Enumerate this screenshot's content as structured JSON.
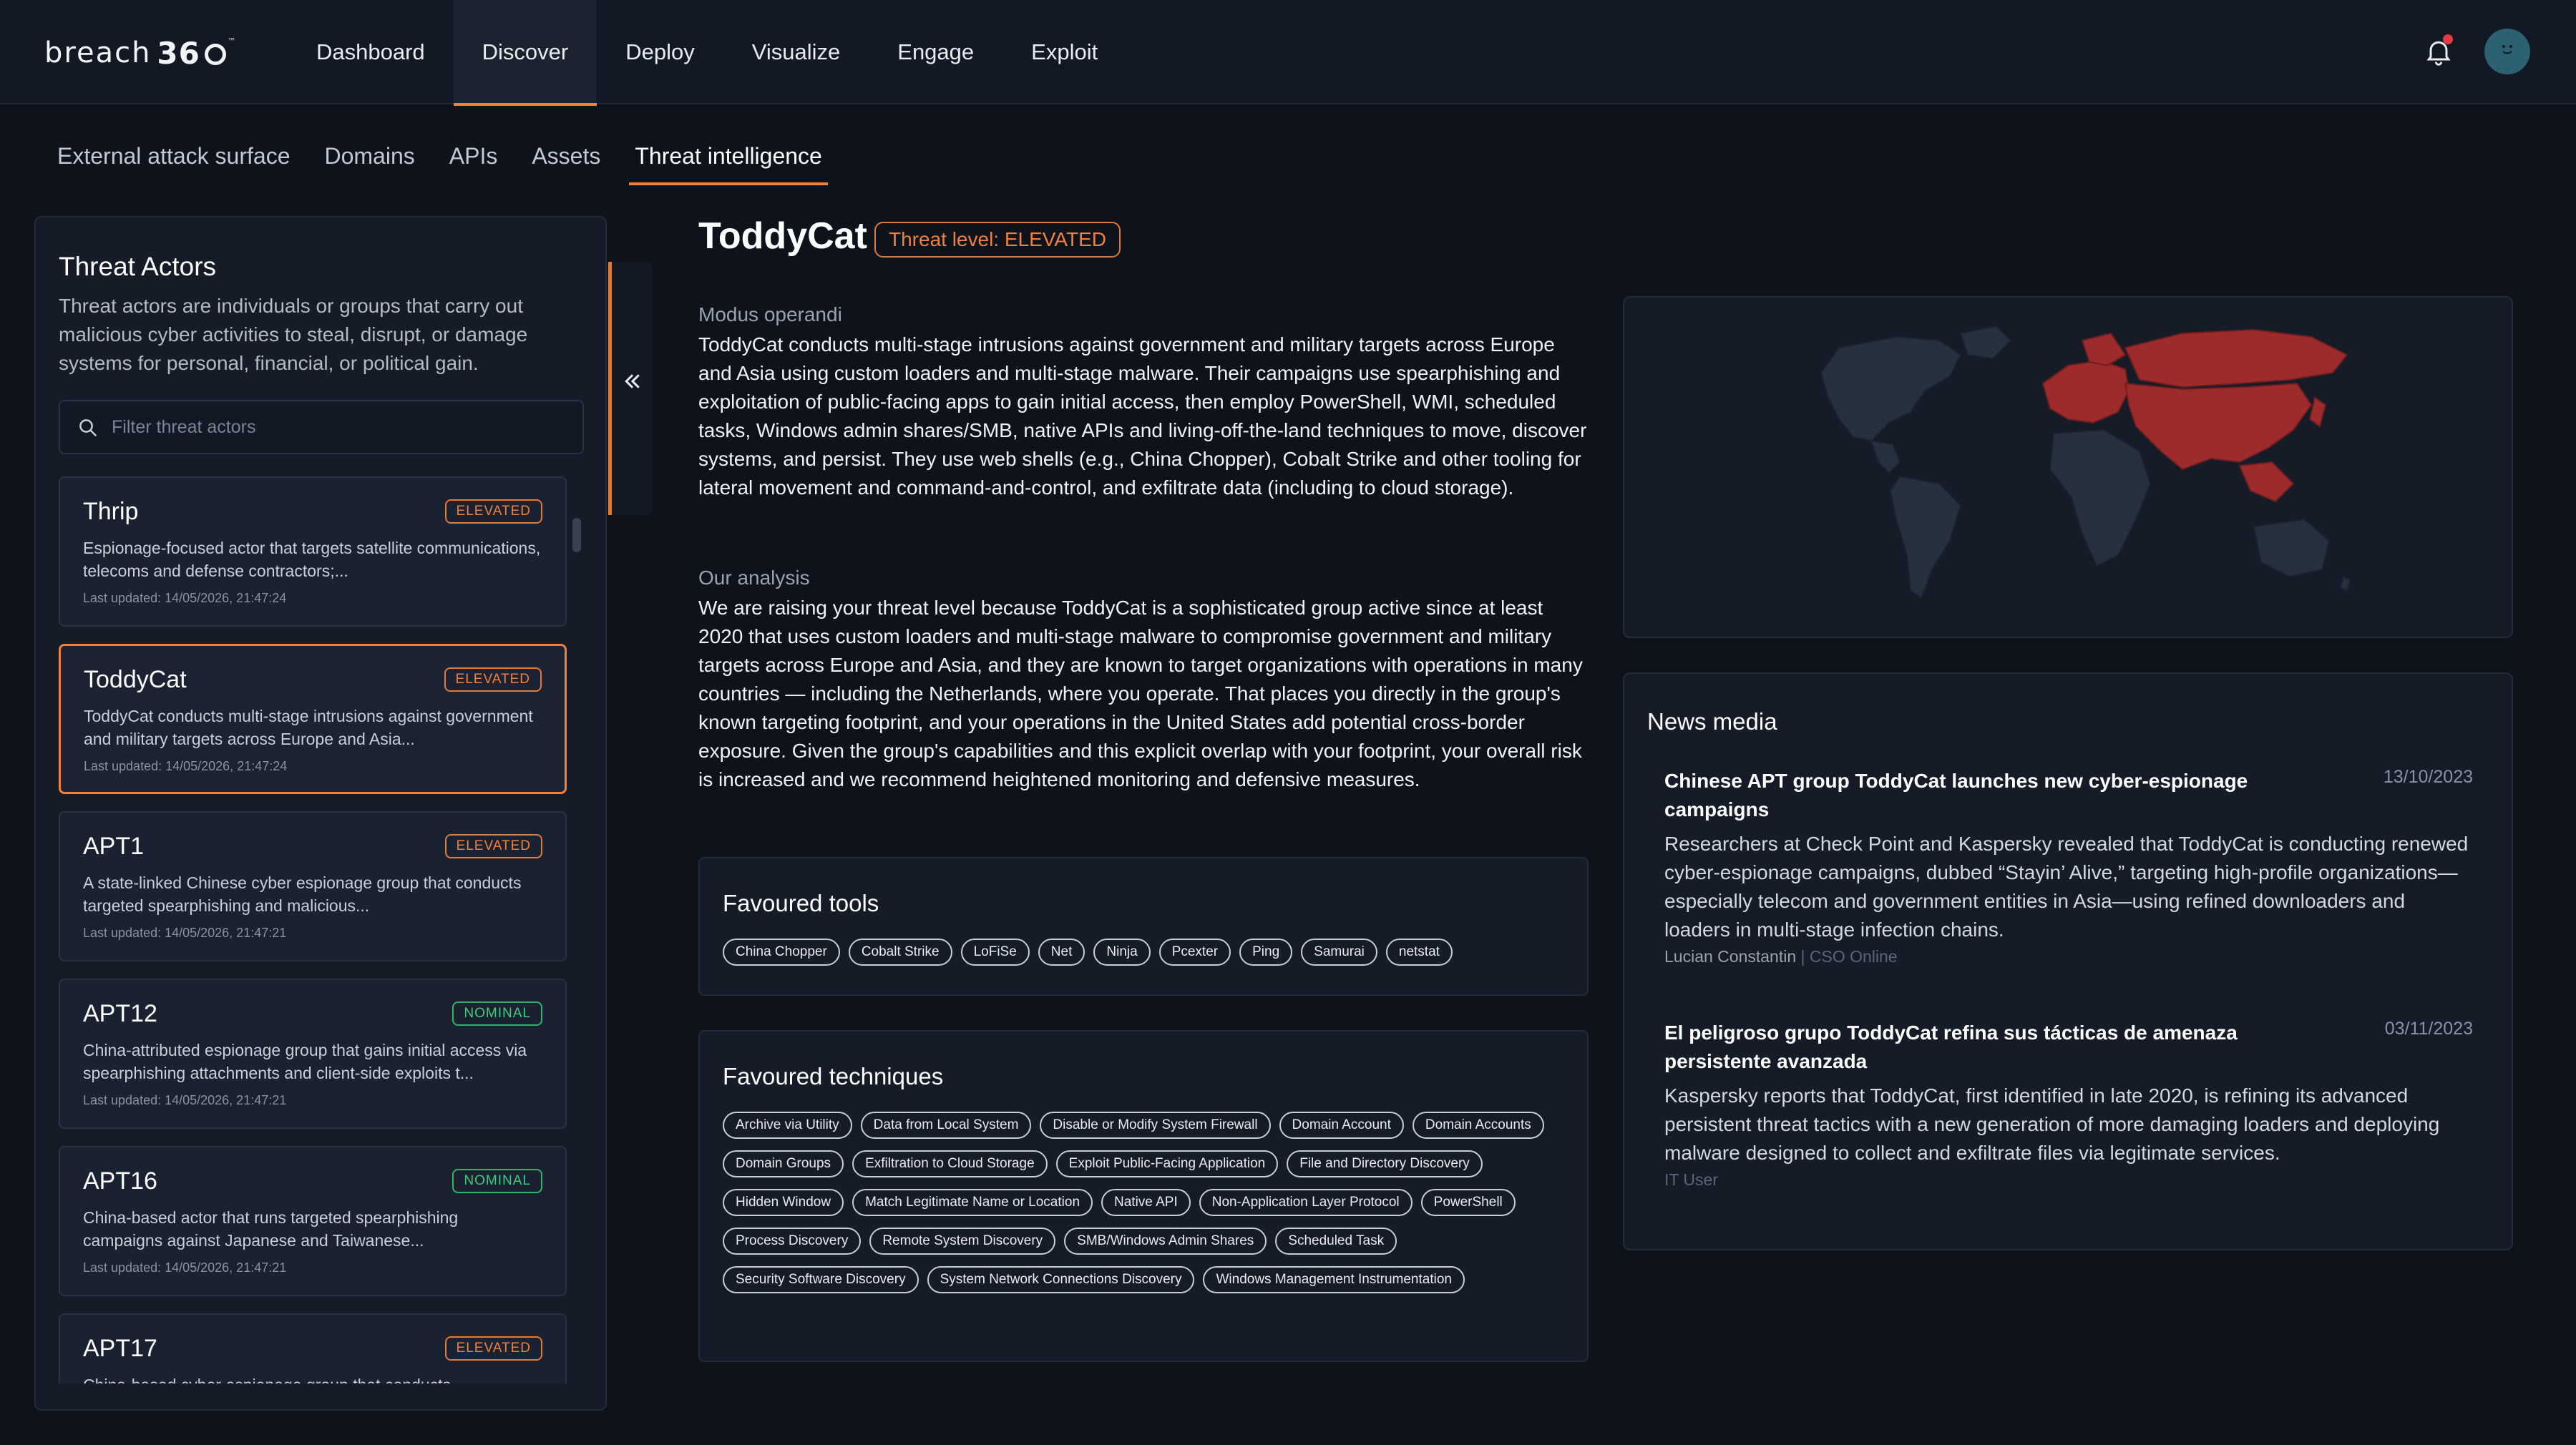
{
  "app": {
    "logo_text": "breach",
    "logo_number": "36",
    "logo_tm": "™"
  },
  "main_nav": [
    "Dashboard",
    "Discover",
    "Deploy",
    "Visualize",
    "Engage",
    "Exploit"
  ],
  "main_nav_active": "Discover",
  "sub_nav": [
    "External attack surface",
    "Domains",
    "APIs",
    "Assets",
    "Threat intelligence"
  ],
  "sub_nav_active": "Threat intelligence",
  "sidebar": {
    "title": "Threat Actors",
    "description": "Threat actors are individuals or groups that carry out malicious cyber activities to steal, disrupt, or damage systems for personal, financial, or political gain.",
    "filter_placeholder": "Filter threat actors",
    "collapse_glyph": "«",
    "actors": [
      {
        "name": "Thrip",
        "level": "ELEVATED",
        "desc": "Espionage-focused actor that targets satellite communications, telecoms and defense contractors;...",
        "updated": "Last updated: 14/05/2026, 21:47:24"
      },
      {
        "name": "ToddyCat",
        "level": "ELEVATED",
        "desc": "ToddyCat conducts multi-stage intrusions against government and military targets across Europe and Asia...",
        "updated": "Last updated: 14/05/2026, 21:47:24",
        "selected": true
      },
      {
        "name": "APT1",
        "level": "ELEVATED",
        "desc": "A state-linked Chinese cyber espionage group that conducts targeted spearphishing and malicious...",
        "updated": "Last updated: 14/05/2026, 21:47:21"
      },
      {
        "name": "APT12",
        "level": "NOMINAL",
        "desc": "China-attributed espionage group that gains initial access via spearphishing attachments and client-side exploits t...",
        "updated": "Last updated: 14/05/2026, 21:47:21"
      },
      {
        "name": "APT16",
        "level": "NOMINAL",
        "desc": "China-based actor that runs targeted spearphishing campaigns against Japanese and Taiwanese...",
        "updated": "Last updated: 14/05/2026, 21:47:21"
      },
      {
        "name": "APT17",
        "level": "ELEVATED",
        "desc": "China-based cyber espionage group that conducts",
        "updated": ""
      }
    ]
  },
  "detail": {
    "name": "ToddyCat",
    "threat_level": "Threat level: ELEVATED",
    "modus_label": "Modus operandi",
    "modus_text": "ToddyCat conducts multi-stage intrusions against government and military targets across Europe and Asia using custom loaders and multi-stage malware. Their campaigns use spearphishing and exploitation of public-facing apps to gain initial access, then employ PowerShell, WMI, scheduled tasks, Windows admin shares/SMB, native APIs and living-off-the-land techniques to move, discover systems, and persist. They use web shells (e.g., China Chopper), Cobalt Strike and other tooling for lateral movement and command-and-control, and exfiltrate data (including to cloud storage).",
    "analysis_label": "Our analysis",
    "analysis_text": "We are raising your threat level because ToddyCat is a sophisticated group active since at least 2020 that uses custom loaders and multi-stage malware to compromise government and military targets across Europe and Asia, and they are known to target organizations with operations in many countries — including the Netherlands, where you operate. That places you directly in the group's known targeting footprint, and your operations in the United States add potential cross-border exposure. Given the group's capabilities and this explicit overlap with your footprint, your overall risk is increased and we recommend heightened monitoring and defensive measures.",
    "tools_title": "Favoured tools",
    "tools": [
      "China Chopper",
      "Cobalt Strike",
      "LoFiSe",
      "Net",
      "Ninja",
      "Pcexter",
      "Ping",
      "Samurai",
      "netstat"
    ],
    "techniques_title": "Favoured techniques",
    "techniques": [
      "Archive via Utility",
      "Data from Local System",
      "Disable or Modify System Firewall",
      "Domain Account",
      "Domain Accounts",
      "Domain Groups",
      "Exfiltration to Cloud Storage",
      "Exploit Public-Facing Application",
      "File and Directory Discovery",
      "Hidden Window",
      "Match Legitimate Name or Location",
      "Native API",
      "Non-Application Layer Protocol",
      "PowerShell",
      "Process Discovery",
      "Remote System Discovery",
      "SMB/Windows Admin Shares",
      "Scheduled Task",
      "Security Software Discovery",
      "System Network Connections Discovery",
      "Windows Management Instrumentation"
    ]
  },
  "news": {
    "title": "News media",
    "items": [
      {
        "headline": "Chinese APT group ToddyCat launches new cyber-espionage campaigns",
        "date": "13/10/2023",
        "body": "Researchers at Check Point and Kaspersky revealed that ToddyCat is conducting renewed cyber-espionage campaigns, dubbed “Stayin’ Alive,” targeting high-profile organizations—especially telecom and government entities in Asia—using refined downloaders and loaders in multi-stage infection chains.",
        "author": "Lucian Constantin",
        "publication": "| CSO Online"
      },
      {
        "headline": "El peligroso grupo ToddyCat refina sus tácticas de amenaza persistente avanzada",
        "date": "03/11/2023",
        "body": "Kaspersky reports that ToddyCat, first identified in late 2020, is refining its advanced persistent threat tactics with a new generation of more damaging loaders and deploying malware designed to collect and exfiltrate files via legitimate services.",
        "author": "",
        "publication": "IT User"
      }
    ]
  },
  "colors": {
    "accent": "#f0803a",
    "elevated": "#f0803a",
    "nominal": "#3ccd7e",
    "map_highlight": "#9e2b2b",
    "map_base": "#27303e",
    "background": "#0d121b"
  },
  "icons": [
    "bell-icon",
    "avatar",
    "search-icon",
    "chevron-double-left-icon",
    "logo-mark-icon"
  ]
}
